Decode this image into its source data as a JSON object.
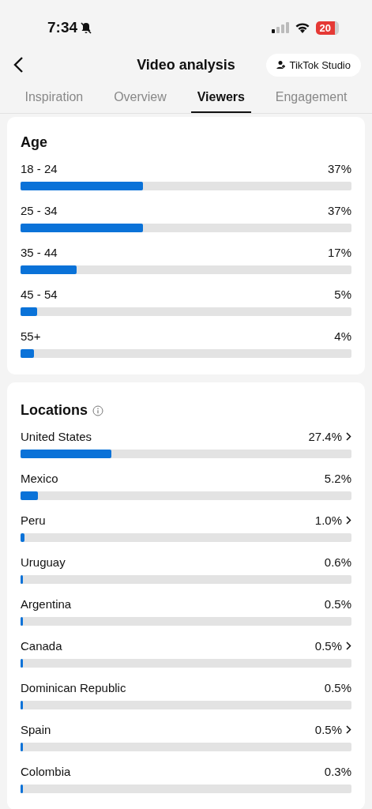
{
  "status_bar": {
    "time": "7:34",
    "battery": "20"
  },
  "header": {
    "title": "Video analysis",
    "studio_button": "TikTok Studio"
  },
  "tabs": [
    {
      "label": "Inspiration",
      "selected": false
    },
    {
      "label": "Overview",
      "selected": false
    },
    {
      "label": "Viewers",
      "selected": true
    },
    {
      "label": "Engagement",
      "selected": false
    }
  ],
  "age": {
    "title": "Age",
    "rows": [
      {
        "label": "18 - 24",
        "value": "37%",
        "level": 0.37
      },
      {
        "label": "25 - 34",
        "value": "37%",
        "level": 0.37
      },
      {
        "label": "35 - 44",
        "value": "17%",
        "level": 0.17
      },
      {
        "label": "45 - 54",
        "value": "5%",
        "level": 0.05
      },
      {
        "label": "55+",
        "value": "4%",
        "level": 0.04
      }
    ]
  },
  "locations": {
    "title": "Locations",
    "rows": [
      {
        "label": "United States",
        "value": "27.4%",
        "level": 0.274,
        "drillable": true
      },
      {
        "label": "Mexico",
        "value": "5.2%",
        "level": 0.052,
        "drillable": false
      },
      {
        "label": "Peru",
        "value": "1.0%",
        "level": 0.012,
        "drillable": true
      },
      {
        "label": "Uruguay",
        "value": "0.6%",
        "level": 0.006,
        "drillable": false
      },
      {
        "label": "Argentina",
        "value": "0.5%",
        "level": 0.005,
        "drillable": false
      },
      {
        "label": "Canada",
        "value": "0.5%",
        "level": 0.005,
        "drillable": true
      },
      {
        "label": "Dominican Republic",
        "value": "0.5%",
        "level": 0.005,
        "drillable": false
      },
      {
        "label": "Spain",
        "value": "0.5%",
        "level": 0.005,
        "drillable": true
      },
      {
        "label": "Colombia",
        "value": "0.3%",
        "level": 0.003,
        "drillable": false
      }
    ]
  }
}
